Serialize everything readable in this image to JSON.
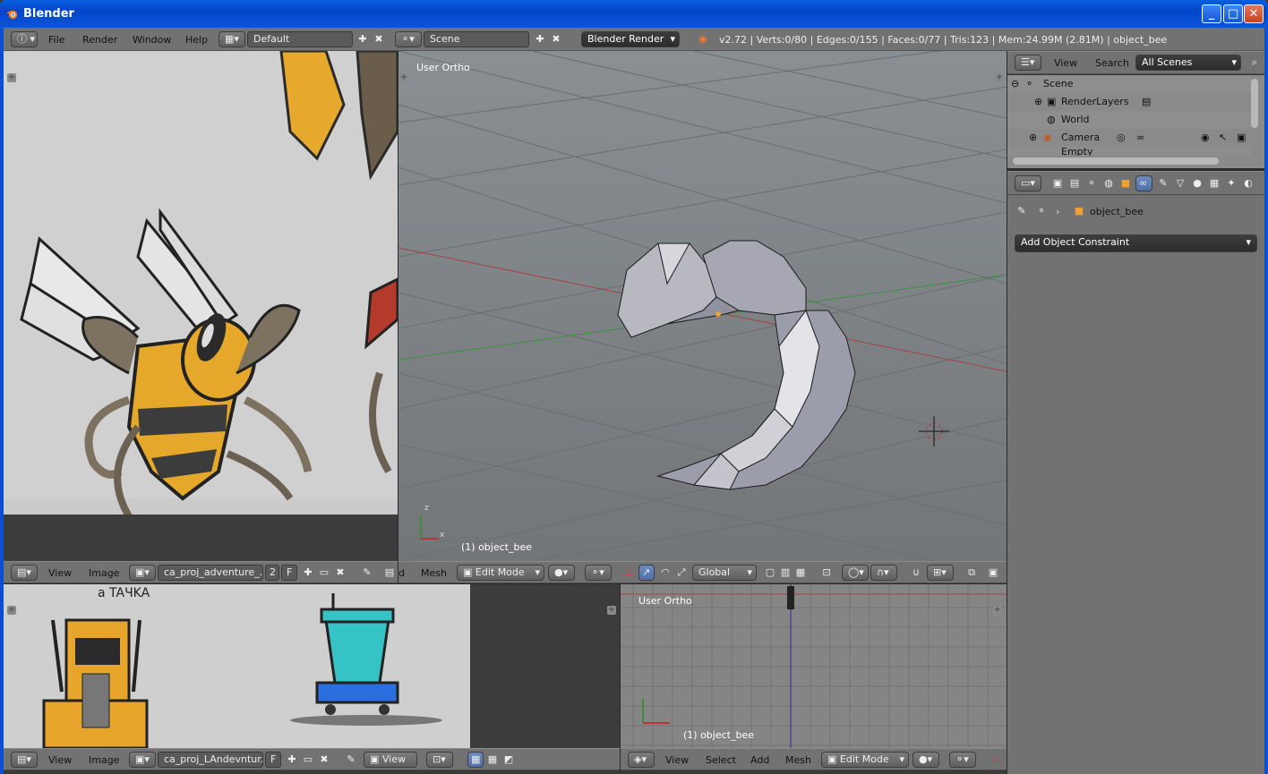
{
  "window": {
    "title": "Blender",
    "minimize": "_",
    "maximize": "□",
    "close": "✕"
  },
  "topbar": {
    "menus": [
      "File",
      "Render",
      "Window",
      "Help"
    ],
    "layout": "Default",
    "scene": "Scene",
    "engine": "Blender Render",
    "stats": "v2.72 | Verts:0/80 | Edges:0/155 | Faces:0/77 | Tris:123 | Mem:24.99M (2.81M) | object_bee"
  },
  "image_editor_top": {
    "menus": [
      "View",
      "Image"
    ],
    "image_name": "ca_proj_adventure_...",
    "users": "2",
    "fake": "F"
  },
  "viewport_main": {
    "label": "User Ortho",
    "object_label": "(1) object_bee",
    "menus_partial": "d",
    "mesh_menu": "Mesh",
    "mode": "Edit Mode",
    "orientation": "Global",
    "axis_z": "z",
    "axis_x": "x"
  },
  "outliner": {
    "menus": [
      "View",
      "Search"
    ],
    "filter": "All Scenes",
    "items": [
      {
        "label": "Scene"
      },
      {
        "label": "RenderLayers"
      },
      {
        "label": "World"
      },
      {
        "label": "Camera"
      },
      {
        "label": "Empty"
      }
    ]
  },
  "properties": {
    "object_name": "object_bee",
    "add_constraint": "Add Object Constraint"
  },
  "image_editor_bottom": {
    "menus": [
      "View",
      "Image"
    ],
    "image_name": "ca_proj_LAndevntur...",
    "fake": "F",
    "view_menu": "View",
    "sketch_text": "a TAЧKA"
  },
  "viewport_bottom": {
    "label": "User Ortho",
    "object_label": "(1) object_bee",
    "menus": [
      "View",
      "Select",
      "Add",
      "Mesh"
    ],
    "mode": "Edit Mode"
  },
  "colors": {
    "accent": "#5680c2",
    "viewport_bg": "#7d8388",
    "header": "#727272"
  }
}
